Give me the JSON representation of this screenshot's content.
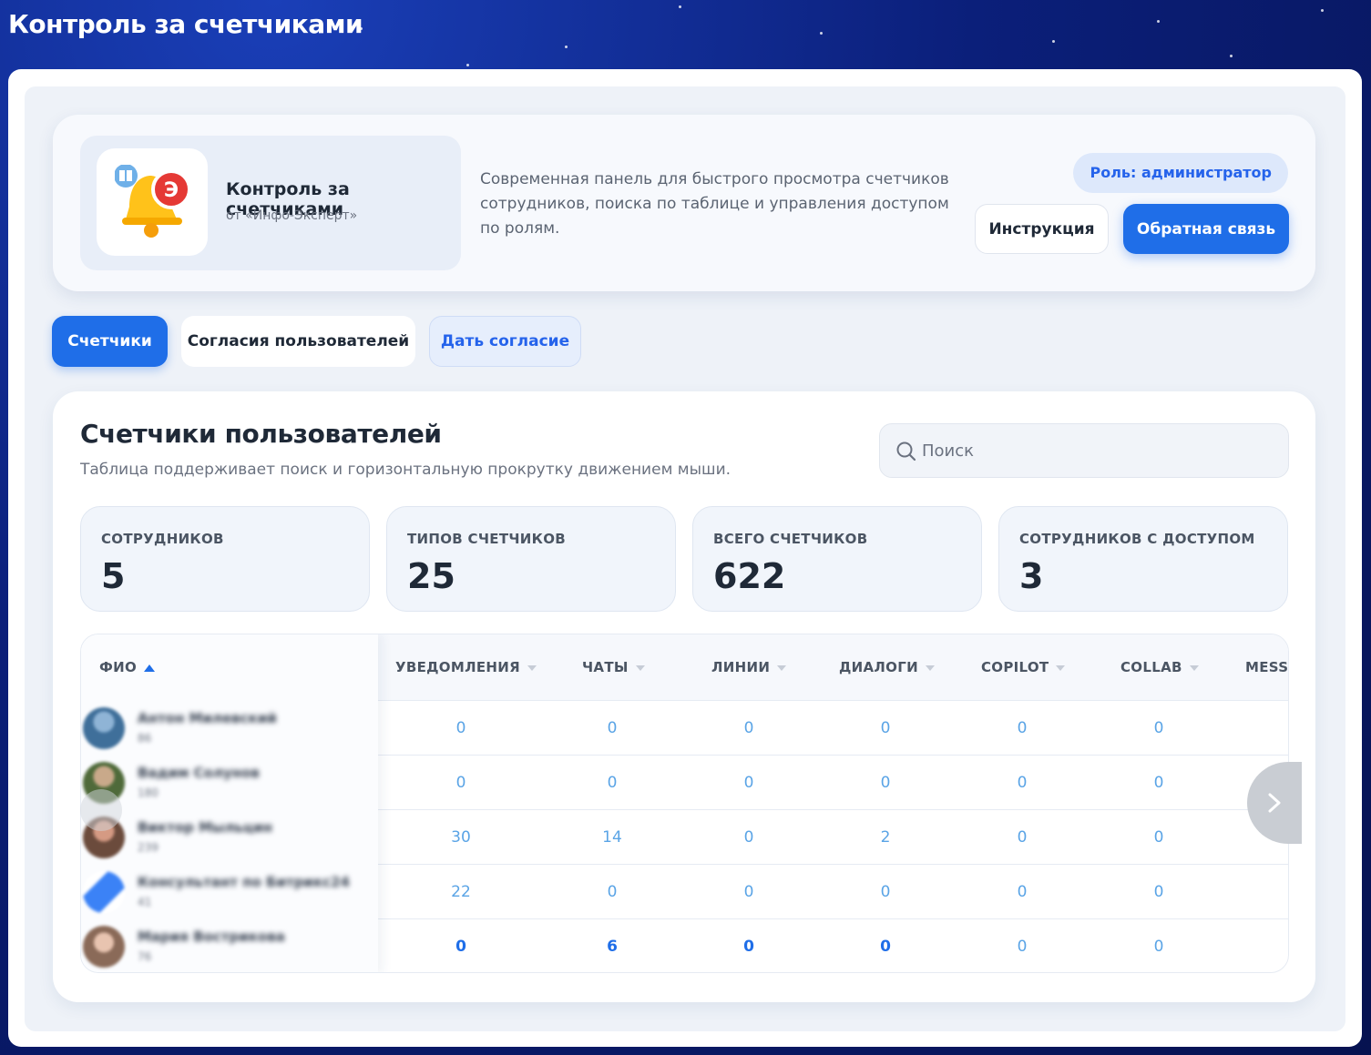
{
  "window": {
    "title": "Контроль за счетчиками"
  },
  "header": {
    "app_name": "Контроль за счетчиками",
    "vendor": "от «Инфо-Эксперт»",
    "description": "Современная панель для быстрого просмотра счетчиков сотрудников, поиска по таблице и управления доступом по ролям.",
    "role": "Роль: администратор",
    "instruction_label": "Инструкция",
    "feedback_label": "Обратная связь",
    "logo_badge": "Э"
  },
  "tabs": [
    {
      "label": "Счетчики",
      "active": true
    },
    {
      "label": "Согласия пользователей",
      "active": false
    },
    {
      "label": "Дать согласие",
      "active": false
    }
  ],
  "main": {
    "title": "Счетчики пользователей",
    "subtitle": "Таблица поддерживает поиск и горизонтальную прокрутку движением мыши.",
    "search": {
      "placeholder": "Поиск",
      "value": ""
    },
    "stats": [
      {
        "label": "СОТРУДНИКОВ",
        "value": "5"
      },
      {
        "label": "ТИПОВ СЧЕТЧИКОВ",
        "value": "25"
      },
      {
        "label": "ВСЕГО СЧЕТЧИКОВ",
        "value": "622"
      },
      {
        "label": "СОТРУДНИКОВ С ДОСТУПОМ",
        "value": "3"
      }
    ]
  },
  "table": {
    "columns": [
      "ФИО",
      "УВЕДОМЛЕНИЯ",
      "ЧАТЫ",
      "ЛИНИИ",
      "ДИАЛОГИ",
      "COPILOT",
      "COLLAB",
      "MESSE"
    ],
    "sort": {
      "column": "ФИО",
      "direction": "asc"
    },
    "rows": [
      {
        "name": "Антон Милевский",
        "id": "86",
        "values": [
          "0",
          "0",
          "0",
          "0",
          "0",
          "0"
        ]
      },
      {
        "name": "Вадим Солунов",
        "id": "180",
        "values": [
          "0",
          "0",
          "0",
          "0",
          "0",
          "0"
        ]
      },
      {
        "name": "Виктор Мыльцин",
        "id": "239",
        "values": [
          "30",
          "14",
          "0",
          "2",
          "0",
          "0"
        ]
      },
      {
        "name": "Консультант по Битрикс24",
        "id": "41",
        "values": [
          "22",
          "0",
          "0",
          "0",
          "0",
          "0"
        ]
      },
      {
        "name": "Мария Вострикова",
        "id": "76",
        "values": [
          "0",
          "6",
          "0",
          "0",
          "0",
          "0"
        ]
      }
    ]
  },
  "colors": {
    "accent": "#1f6ee8",
    "value_blue": "#5aa4e6",
    "page_bg": "#eef2f8"
  }
}
